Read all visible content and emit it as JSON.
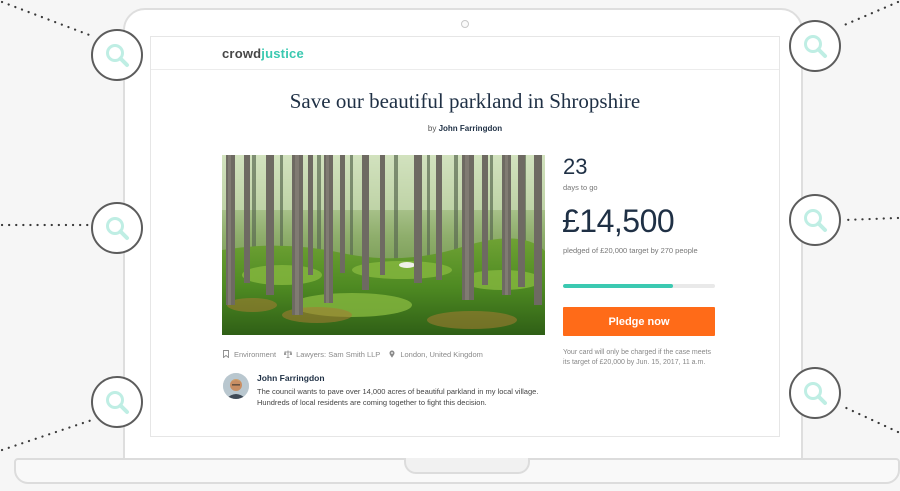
{
  "site": {
    "logo_part1": "crowd",
    "logo_part2": "justice"
  },
  "campaign": {
    "title": "Save our beautiful parkland in Shropshire",
    "by_prefix": "by",
    "author": "John Farringdon"
  },
  "stats": {
    "days_count": "23",
    "days_label": "days to go",
    "amount": "£14,500",
    "pledged_label": "pledged of £20,000 target by 270 people",
    "progress_fraction": 0.725
  },
  "pledge": {
    "button_label": "Pledge now",
    "card_note": "Your card will only be charged if the case meets its target of £20,000 by Jun. 15, 2017, 11 a.m."
  },
  "meta": {
    "category": "Environment",
    "lawyers": "Lawyers: Sam Smith LLP",
    "location": "London, United Kingdom"
  },
  "author_block": {
    "name": "John Farringdon",
    "description": "The council wants to pave over 14,000 acres of beautiful parkland in my local village. Hundreds of local residents are coming together to fight this decision."
  },
  "colors": {
    "accent": "#3bc9b1",
    "button": "#ff6b18",
    "text_dark": "#1f3045"
  }
}
